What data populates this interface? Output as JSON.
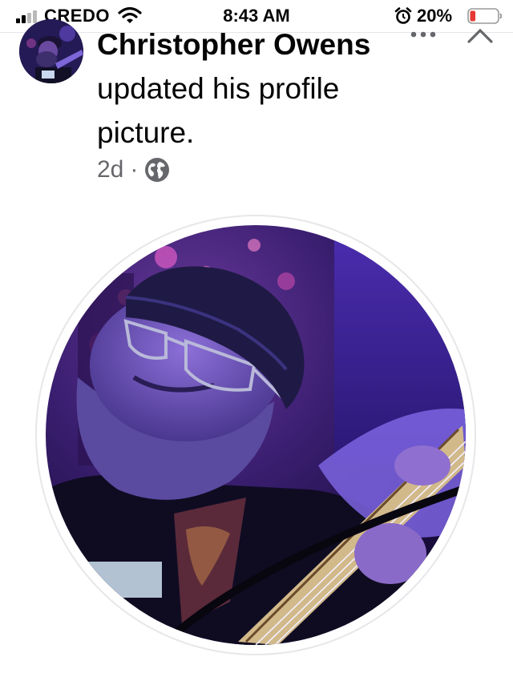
{
  "status_bar": {
    "carrier": "CREDO",
    "time": "8:43 AM",
    "battery_percent": "20%",
    "battery_level": 0.2,
    "signal_bars_active": 2,
    "signal_bars_total": 4,
    "icons": [
      "signal-icon",
      "wifi-icon",
      "alarm-icon",
      "battery-icon"
    ]
  },
  "post": {
    "author_name": "Christopher Owens",
    "action_text": "updated his profile picture.",
    "timestamp": "2d",
    "separator": "·",
    "audience_icon": "globe-icon",
    "menu_icon": "more-icon",
    "close_icon": "close-icon"
  },
  "colors": {
    "text_primary": "#050505",
    "text_secondary": "#65676b",
    "battery_low": "#e53935",
    "divider": "#e4e6eb"
  }
}
